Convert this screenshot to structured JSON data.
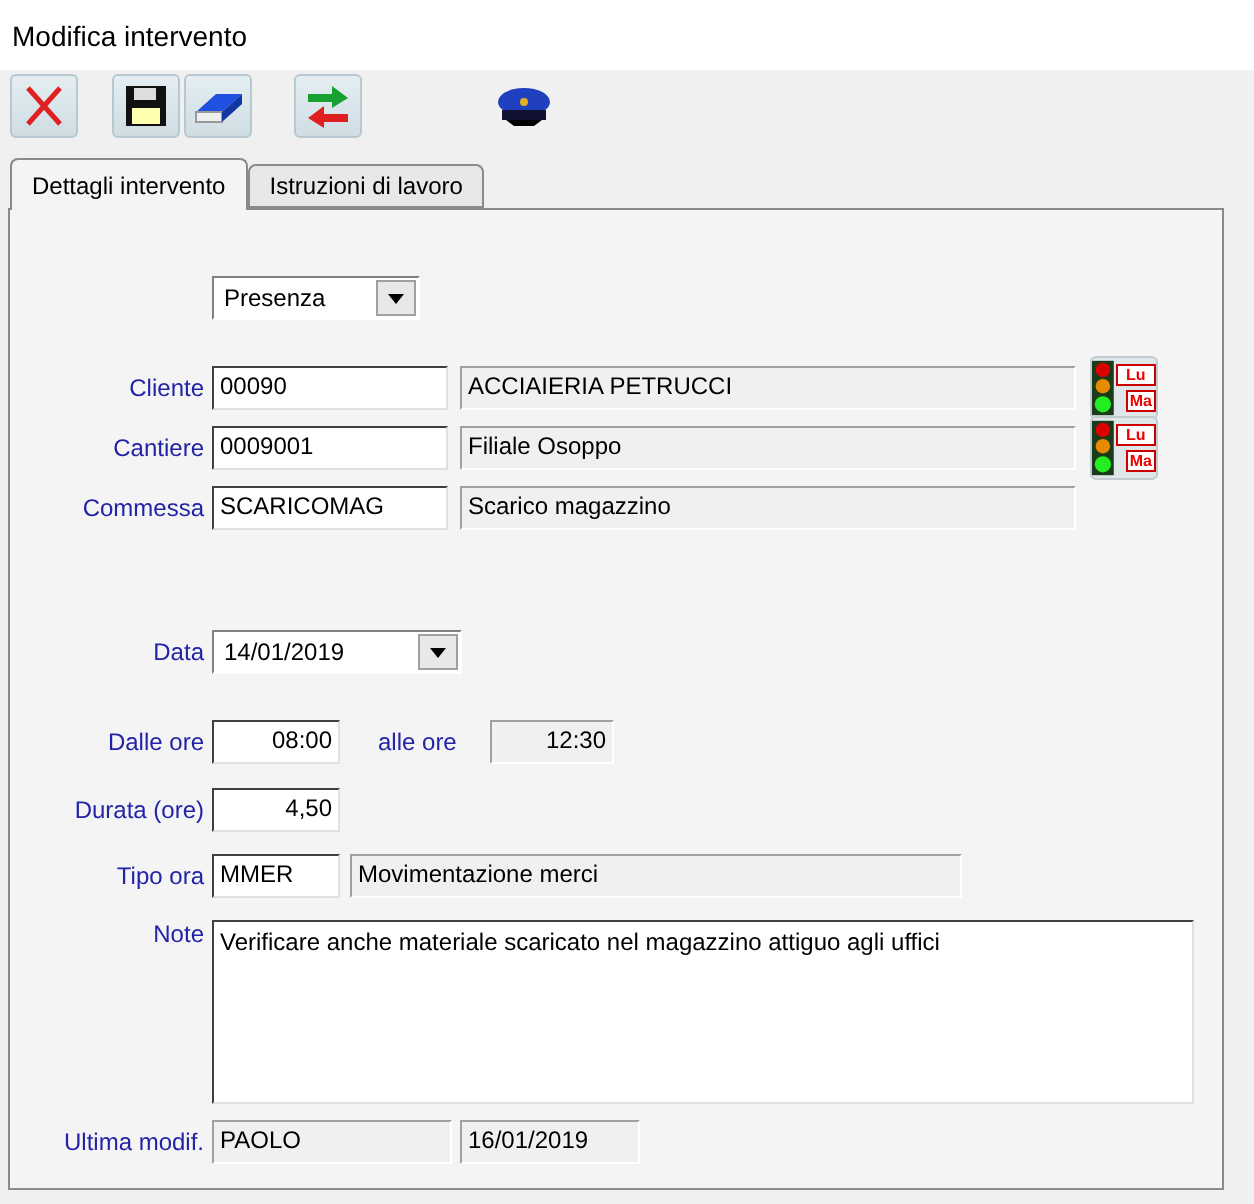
{
  "window": {
    "title": "Modifica intervento"
  },
  "tabs": [
    {
      "label": "Dettagli intervento",
      "selected": true
    },
    {
      "label": "Istruzioni di lavoro",
      "selected": false
    }
  ],
  "type_select": {
    "value": "Presenza"
  },
  "lookups": [
    {
      "label": "Cliente",
      "code": "00090",
      "description": "ACCIAIERIA PETRUCCI",
      "status_button": true,
      "button_labels": [
        "Lu",
        "Ma"
      ]
    },
    {
      "label": "Cantiere",
      "code": "0009001",
      "description": "Filiale Osoppo",
      "status_button": true,
      "button_labels": [
        "Lu",
        "Ma"
      ]
    },
    {
      "label": "Commessa",
      "code": "SCARICOMAG",
      "description": "Scarico magazzino",
      "status_button": false
    }
  ],
  "date": {
    "label": "Data",
    "value": "14/01/2019"
  },
  "time_from": {
    "label": "Dalle ore",
    "value": "08:00"
  },
  "time_to": {
    "label": "alle ore",
    "value": "12:30"
  },
  "duration": {
    "label": "Durata (ore)",
    "value": "4,50"
  },
  "hour_type": {
    "label": "Tipo ora",
    "code": "MMER",
    "description": "Movimentazione merci"
  },
  "note": {
    "label": "Note",
    "value": "Verificare anche materiale scaricato nel magazzino attiguo agli uffici"
  },
  "last_modified": {
    "label": "Ultima modif.",
    "user": "PAOLO",
    "date": "16/01/2019"
  }
}
